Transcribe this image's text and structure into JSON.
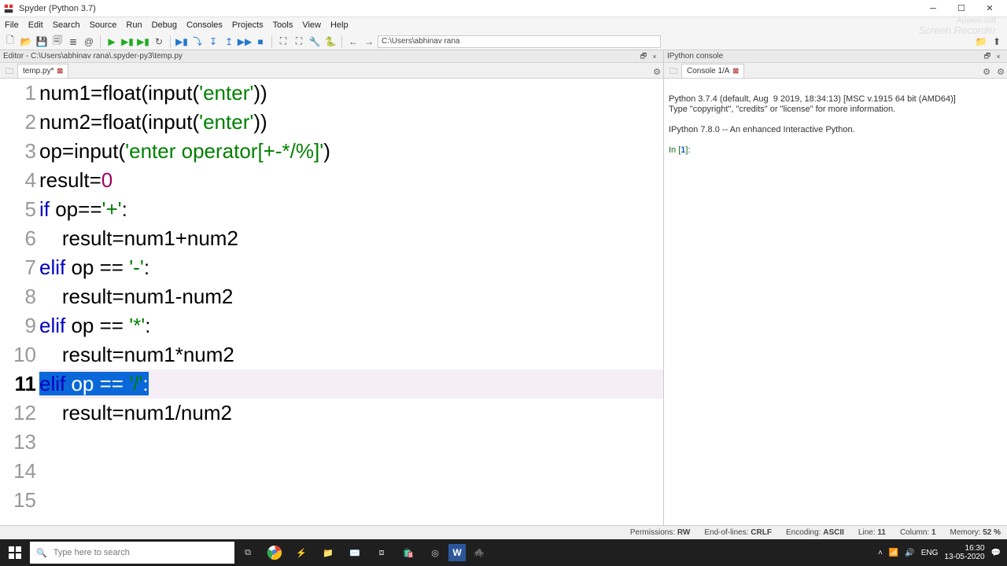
{
  "title": "Spyder (Python 3.7)",
  "menu": [
    "File",
    "Edit",
    "Search",
    "Source",
    "Run",
    "Debug",
    "Consoles",
    "Projects",
    "Tools",
    "View",
    "Help"
  ],
  "path_field": "C:\\Users\\abhinav rana",
  "watermark": {
    "l1": "Apowersoft",
    "l2": "Screen Recorder"
  },
  "editor": {
    "pane_title": "Editor - C:\\Users\\abhinav rana\\.spyder-py3\\temp.py",
    "tab_label": "temp.py*",
    "lines": [
      "num1=float(input('enter'))",
      "num2=float(input('enter'))",
      "op=input('enter operator[+-*/%]')",
      "result=0",
      "if op=='+':",
      "    result=num1+num2",
      "elif op == '-':",
      "    result=num1-num2",
      "elif op == '*':",
      "    result=num1*num2",
      "elif op == '/':",
      "    result=num1/num2",
      "",
      "",
      ""
    ],
    "current_line": 11,
    "selection_text": "elif op == '/':"
  },
  "console": {
    "pane_title": "IPython console",
    "tab_label": "Console 1/A",
    "banner_l1": "Python 3.7.4 (default, Aug  9 2019, 18:34:13) [MSC v.1915 64 bit (AMD64)]",
    "banner_l2": "Type \"copyright\", \"credits\" or \"license\" for more information.",
    "banner_l3": "IPython 7.8.0 -- An enhanced Interactive Python.",
    "prompt": "In [1]:"
  },
  "status": {
    "permissions": "RW",
    "eol": "CRLF",
    "encoding": "ASCII",
    "line": "11",
    "column": "1",
    "memory": "52 %"
  },
  "taskbar": {
    "search_placeholder": "Type here to search",
    "time": "16:30",
    "date": "13-05-2020",
    "lang": "ENG"
  }
}
